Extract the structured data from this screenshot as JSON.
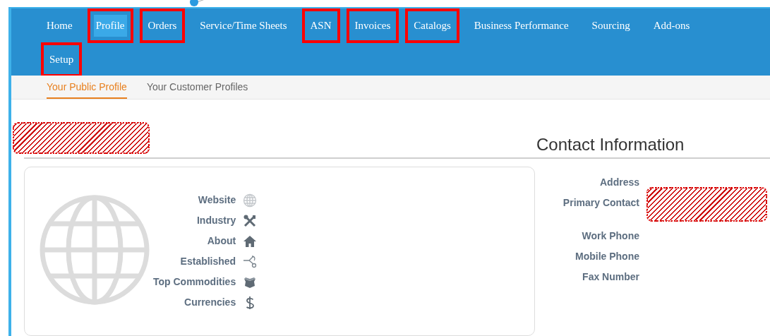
{
  "nav": {
    "items": [
      {
        "label": "Home",
        "selected": false,
        "highlighted": false
      },
      {
        "label": "Profile",
        "selected": true,
        "highlighted": true
      },
      {
        "label": "Orders",
        "selected": false,
        "highlighted": true
      },
      {
        "label": "Service/Time Sheets",
        "selected": false,
        "highlighted": false
      },
      {
        "label": "ASN",
        "selected": false,
        "highlighted": true
      },
      {
        "label": "Invoices",
        "selected": false,
        "highlighted": true
      },
      {
        "label": "Catalogs",
        "selected": false,
        "highlighted": true
      },
      {
        "label": "Business Performance",
        "selected": false,
        "highlighted": false
      },
      {
        "label": "Sourcing",
        "selected": false,
        "highlighted": false
      },
      {
        "label": "Add-ons",
        "selected": false,
        "highlighted": false
      },
      {
        "label": "Setup",
        "selected": false,
        "highlighted": true
      }
    ]
  },
  "subnav": {
    "tabs": [
      {
        "label": "Your Public Profile",
        "selected": true
      },
      {
        "label": "Your Customer Profiles",
        "selected": false
      }
    ]
  },
  "profile_name": {
    "redacted": true
  },
  "profile_card": {
    "fields": [
      {
        "label": "Website"
      },
      {
        "label": "Industry"
      },
      {
        "label": "About"
      },
      {
        "label": "Established"
      },
      {
        "label": "Top Commodities"
      },
      {
        "label": "Currencies"
      }
    ]
  },
  "contact": {
    "title": "Contact Information",
    "fields": [
      {
        "label": "Address",
        "redacted": false
      },
      {
        "label": "Primary Contact",
        "redacted": true
      },
      {
        "label": "Work Phone",
        "redacted": false
      },
      {
        "label": "Mobile Phone",
        "redacted": false
      },
      {
        "label": "Fax Number",
        "redacted": false
      }
    ]
  }
}
